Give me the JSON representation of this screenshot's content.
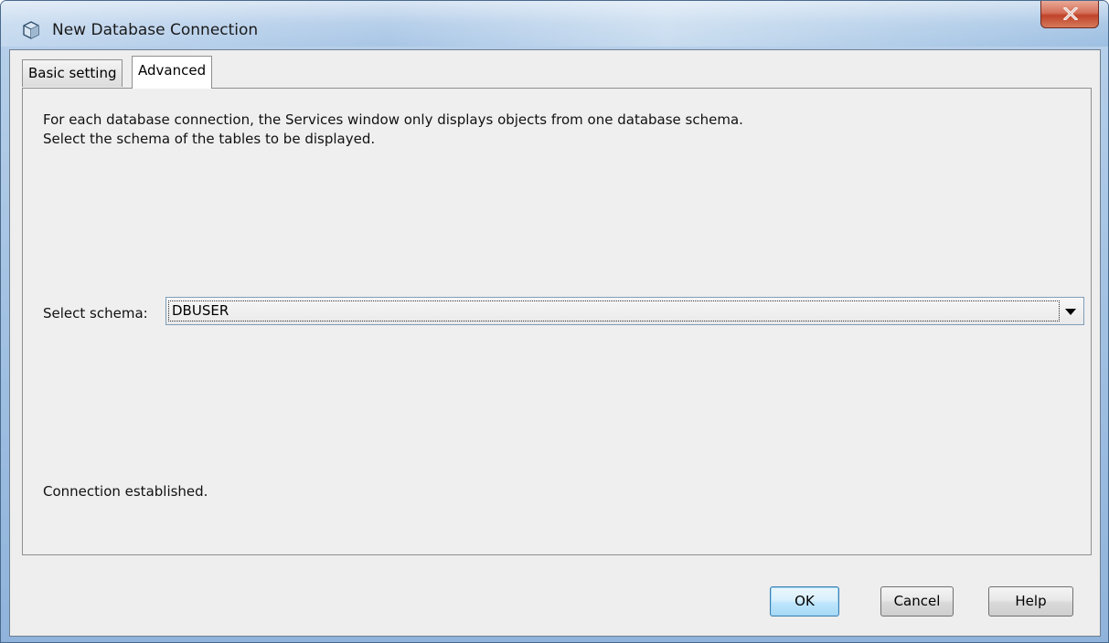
{
  "window": {
    "title": "New Database Connection",
    "icon": "database-cube-icon"
  },
  "tabs": [
    {
      "label": "Basic setting",
      "active": false
    },
    {
      "label": "Advanced",
      "active": true
    }
  ],
  "advanced": {
    "description_line1": "For each database connection, the Services window only displays objects from one database schema.",
    "description_line2": "Select the schema of the tables to be displayed.",
    "schema_label": "Select schema:",
    "schema_value": "DBUSER",
    "status": "Connection established."
  },
  "buttons": {
    "ok": "OK",
    "cancel": "Cancel",
    "help": "Help"
  },
  "colors": {
    "close_button": "#c0432a",
    "default_button_border": "#3c7fb1"
  }
}
